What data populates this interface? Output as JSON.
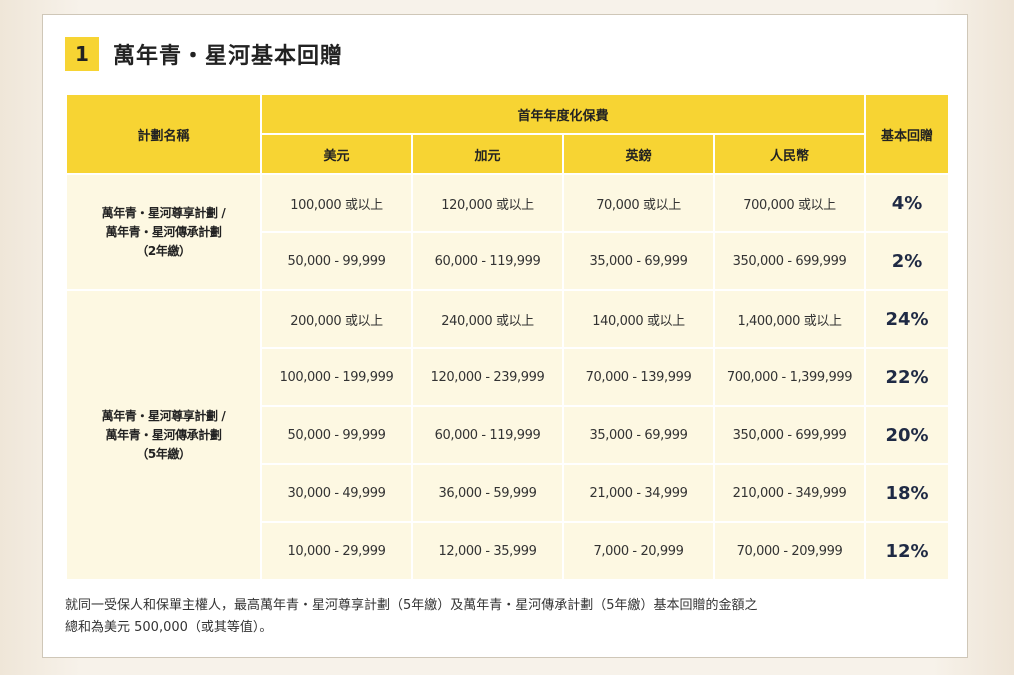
{
  "section": {
    "number": "1",
    "title": "萬年青・星河基本回贈"
  },
  "table": {
    "headers": {
      "plan_name": "計劃名稱",
      "premium_group": "首年年度化保費",
      "rebate": "基本回贈",
      "currencies": [
        "美元",
        "加元",
        "英鎊",
        "人民幣"
      ]
    },
    "groups": [
      {
        "plan_lines": [
          "萬年青・星河尊享計劃 /",
          "萬年青・星河傳承計劃",
          "（2年繳）"
        ],
        "rows": [
          {
            "usd": "100,000 或以上",
            "cad": "120,000 或以上",
            "gbp": "70,000 或以上",
            "rmb": "700,000 或以上",
            "rate": "4%"
          },
          {
            "usd": "50,000 - 99,999",
            "cad": "60,000 - 119,999",
            "gbp": "35,000 - 69,999",
            "rmb": "350,000 - 699,999",
            "rate": "2%"
          }
        ]
      },
      {
        "plan_lines": [
          "萬年青・星河尊享計劃 /",
          "萬年青・星河傳承計劃",
          "（5年繳）"
        ],
        "rows": [
          {
            "usd": "200,000 或以上",
            "cad": "240,000 或以上",
            "gbp": "140,000 或以上",
            "rmb": "1,400,000 或以上",
            "rate": "24%"
          },
          {
            "usd": "100,000 - 199,999",
            "cad": "120,000 - 239,999",
            "gbp": "70,000 - 139,999",
            "rmb": "700,000 - 1,399,999",
            "rate": "22%"
          },
          {
            "usd": "50,000 - 99,999",
            "cad": "60,000 - 119,999",
            "gbp": "35,000 - 69,999",
            "rmb": "350,000 - 699,999",
            "rate": "20%"
          },
          {
            "usd": "30,000 - 49,999",
            "cad": "36,000 - 59,999",
            "gbp": "21,000 - 34,999",
            "rmb": "210,000 - 349,999",
            "rate": "18%"
          },
          {
            "usd": "10,000 - 29,999",
            "cad": "12,000 - 35,999",
            "gbp": "7,000 - 20,999",
            "rmb": "70,000 - 209,999",
            "rate": "12%"
          }
        ]
      }
    ]
  },
  "footnote": {
    "line1": "就同一受保人和保單主權人，最高萬年青・星河尊享計劃（5年繳）及萬年青・星河傳承計劃（5年繳）基本回贈的金額之",
    "line2": "總和為美元 500,000（或其等值）。"
  },
  "colors": {
    "header_yellow": "#f7d433",
    "cell_cream": "#fdf8e2",
    "rate_navy": "#1f2a44"
  }
}
